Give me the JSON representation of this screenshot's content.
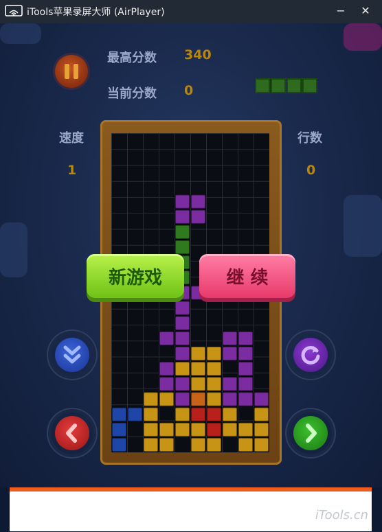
{
  "window": {
    "title": "iTools苹果录屏大师 (AirPlayer)",
    "minimize": "−",
    "close": "✕"
  },
  "hud": {
    "best_label": "最高分数",
    "best_value": "340",
    "current_label": "当前分数",
    "current_value": "0",
    "speed_label": "速度",
    "speed_value": "1",
    "lines_label": "行数",
    "lines_value": "0"
  },
  "buttons": {
    "new_game": "新游戏",
    "resume": "继 续"
  },
  "watermark": "iTools.cn",
  "board": {
    "cols": 10,
    "rows": 20,
    "colors": {
      "P": "#7a2ca0",
      "G": "#2f7a1f",
      "Y": "#c89416",
      "B": "#1e46a8",
      "O": "#c8641a",
      "R": "#b8201c"
    },
    "grid": [
      "..........",
      "..........",
      "..........",
      "..........",
      "....PP....",
      "....PP....",
      "....G.....",
      "....G.....",
      "....G.....",
      "....G.....",
      "....PP....",
      "....P.....",
      "....P.....",
      "...PP..PP.",
      "....PYYPP.",
      "...PYYY.P.",
      "...PPYYPP.",
      "..YYPOYPPP",
      "BBY.YRRY.Y",
      "B.YYYYRYYY",
      "B.YY.YY.YY"
    ]
  }
}
